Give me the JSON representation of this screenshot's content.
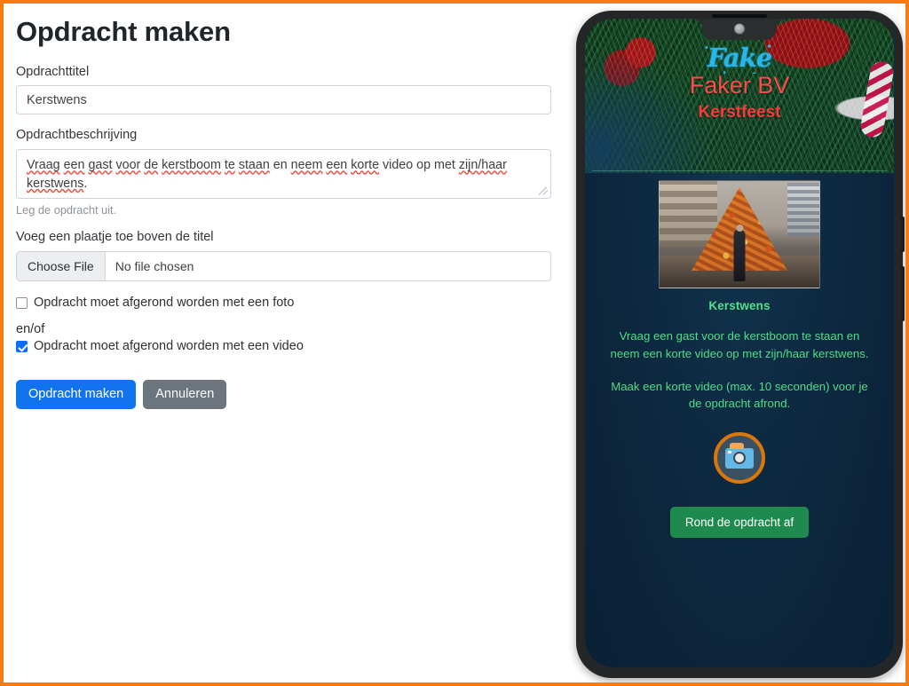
{
  "form": {
    "title": "Opdracht maken",
    "title_label": "Opdrachttitel",
    "title_value": "Kerstwens",
    "description_label": "Opdrachtbeschrijving",
    "description_value": "Vraag een gast voor de kerstboom te staan en neem een korte video op met zijn/haar kerstwens.",
    "description_help": "Leg de opdracht uit.",
    "image_label": "Voeg een plaatje toe boven de titel",
    "file_button": "Choose File",
    "file_status": "No file chosen",
    "photo_checkbox_label": "Opdracht moet afgerond worden met een foto",
    "photo_checked": false,
    "andor_label": "en/of",
    "video_checkbox_label": "Opdracht moet afgerond worden met een video",
    "video_checked": true,
    "submit_label": "Opdracht maken",
    "cancel_label": "Annuleren"
  },
  "preview": {
    "logo_text": "Fake",
    "brand_name": "Faker BV",
    "brand_sub": "Kerstfeest",
    "task_title": "Kerstwens",
    "task_description": "Vraag een gast voor de kerstboom te staan en neem een korte video op met zijn/haar kerstwens.",
    "task_instruction": "Maak een korte video (max. 10 seconden) voor je de opdracht afrond.",
    "finish_button": "Rond de opdracht af"
  },
  "colors": {
    "page_border": "#f97b16",
    "primary_button": "#1273ef",
    "secondary_button": "#6c757d",
    "checkbox_checked": "#0d6efd",
    "preview_green_text": "#4fdd86",
    "preview_red_text": "#fd4b4b",
    "preview_logo_cyan": "#29b6e8",
    "preview_background": "#0d2940",
    "finish_button": "#1e8a4d",
    "camera_ring": "#d9770a"
  }
}
